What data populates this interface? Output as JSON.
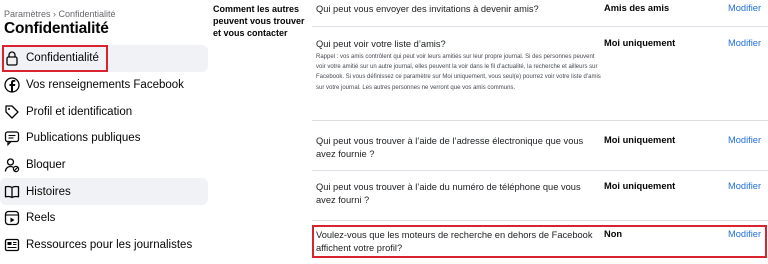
{
  "breadcrumb": "Paramètres › Confidentialité",
  "title": "Confidentialité",
  "nav": [
    {
      "label": "Confidentialité",
      "icon": "lock-icon"
    },
    {
      "label": "Vos renseignements Facebook",
      "icon": "facebook-icon"
    },
    {
      "label": "Profil et identification",
      "icon": "tag-icon"
    },
    {
      "label": "Publications publiques",
      "icon": "speech-bubble-icon"
    },
    {
      "label": "Bloquer",
      "icon": "block-user-icon"
    },
    {
      "label": "Histoires",
      "icon": "book-icon"
    },
    {
      "label": "Reels",
      "icon": "play-icon"
    },
    {
      "label": "Ressources pour les journalistes",
      "icon": "newspaper-icon"
    }
  ],
  "section_label": "Comment les autres peuvent vous trouver et vous contacter",
  "rows": [
    {
      "question": "Qui peut vous envoyer des invitations à devenir amis?",
      "value": "Amis des amis",
      "edit": "Modifier"
    },
    {
      "question": "Qui peut voir votre liste d’amis?",
      "note": "Rappel : vos amis contrôlent qui peut voir leurs amitiés sur leur propre journal. Si des personnes peuvent voir votre amitié sur un autre journal, elles peuvent la voir dans le fil d’actualité, la recherche et ailleurs sur Facebook. Si vous définissez ce paramètre sur Moi uniquement, vous seul(e) pourrez voir votre liste d’amis sur votre journal. Les autres personnes ne verront que vos amis communs.",
      "value": "Moi uniquement",
      "edit": "Modifier"
    },
    {
      "question": "Qui peut vous trouver à l’aide de l’adresse électronique que vous avez fournie ?",
      "value": "Moi uniquement",
      "edit": "Modifier"
    },
    {
      "question": "Qui peut vous trouver à l’aide du numéro de téléphone que vous avez fourni ?",
      "value": "Moi uniquement",
      "edit": "Modifier"
    },
    {
      "question": "Voulez-vous que les moteurs de recherche en dehors de Facebook affichent votre profil?",
      "value": "Non",
      "edit": "Modifier"
    }
  ],
  "colors": {
    "accent_red": "#d9232e",
    "link_blue": "#216fdb",
    "shade": "#f0f2f5"
  }
}
